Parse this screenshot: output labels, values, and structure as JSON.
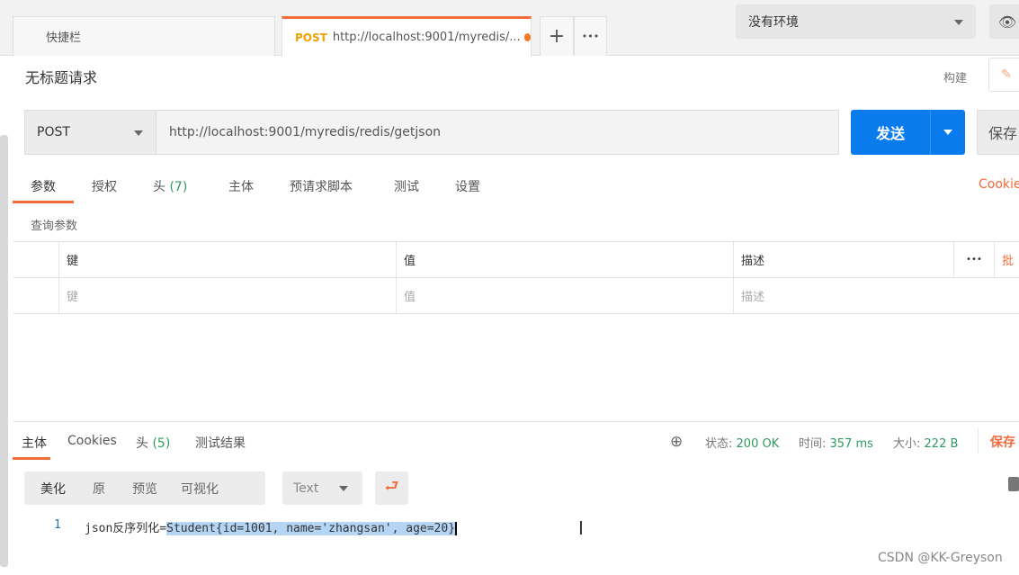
{
  "tabs": {
    "quick": "快捷栏",
    "active_method": "POST",
    "active_url": "http://localhost:9001/myredis/...",
    "new": "+",
    "more": "•••"
  },
  "environment": {
    "selected": "没有环境"
  },
  "request": {
    "title": "无标题请求",
    "build": "构建",
    "method": "POST",
    "url": "http://localhost:9001/myredis/redis/getjson",
    "send": "发送",
    "save": "保存"
  },
  "req_tabs": [
    {
      "label": "参数"
    },
    {
      "label": "授权"
    },
    {
      "label": "头",
      "count": "(7)"
    },
    {
      "label": "主体"
    },
    {
      "label": "预请求脚本"
    },
    {
      "label": "测试"
    },
    {
      "label": "设置"
    }
  ],
  "cookies_link": "Cookie",
  "params": {
    "section": "查询参数",
    "headers": [
      "键",
      "值",
      "描述"
    ],
    "more": "•••",
    "bulk": "批",
    "placeholders": [
      "键",
      "值",
      "描述"
    ]
  },
  "response": {
    "tabs": [
      {
        "label": "主体"
      },
      {
        "label": "Cookies"
      },
      {
        "label": "头",
        "count": "(5)"
      },
      {
        "label": "测试结果"
      }
    ],
    "status_label": "状态:",
    "status": "200 OK",
    "time_label": "时间:",
    "time": "357 ms",
    "size_label": "大小:",
    "size": "222 B",
    "save": "保存",
    "views": [
      "美化",
      "原",
      "预览",
      "可视化"
    ],
    "format": "Text",
    "line_number": "1",
    "line_prefix": "json反序列化=",
    "line_selected": "Student{id=1001, name='zhangsan', age=20}"
  },
  "watermark": "CSDN @KK-Greyson",
  "colors": {
    "accent": "#f26b3a",
    "send": "#097bed",
    "status": "#2f9a5e"
  }
}
